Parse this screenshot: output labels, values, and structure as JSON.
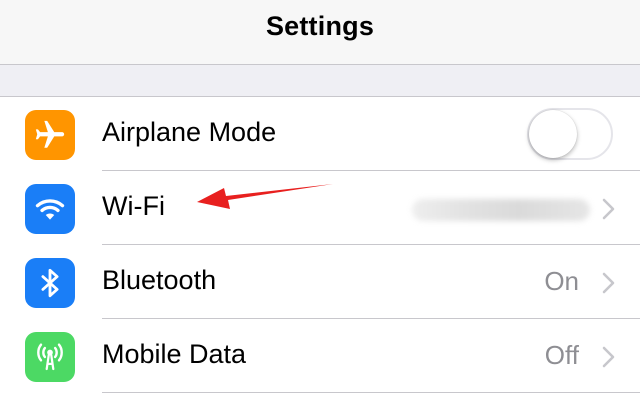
{
  "navbar": {
    "title": "Settings"
  },
  "rows": [
    {
      "label": "Airplane Mode",
      "icon": "airplane-icon",
      "icon_color": "#ff9500",
      "control": "toggle",
      "toggle_on": false
    },
    {
      "label": "Wi-Fi",
      "icon": "wifi-icon",
      "icon_color": "#1a7ef7",
      "value": "",
      "value_obscured": true,
      "control": "chevron"
    },
    {
      "label": "Bluetooth",
      "icon": "bluetooth-icon",
      "icon_color": "#1a7ef7",
      "value": "On",
      "control": "chevron"
    },
    {
      "label": "Mobile Data",
      "icon": "antenna-icon",
      "icon_color": "#4cd964",
      "value": "Off",
      "control": "chevron"
    }
  ],
  "annotation": {
    "type": "arrow",
    "color": "#e8201f",
    "points_to": "Wi-Fi"
  },
  "colors": {
    "background": "#efeff4",
    "separator": "#c8c7cc",
    "secondary_text": "#8e8e93"
  }
}
